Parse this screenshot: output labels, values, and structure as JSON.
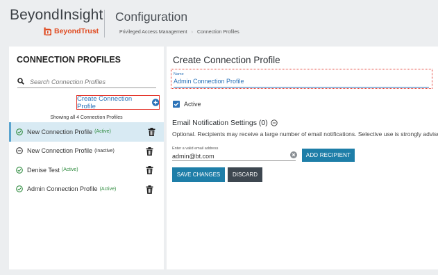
{
  "header": {
    "brand": "BeyondInsight",
    "vendor_logo": "BeyondTrust",
    "app_title": "Configuration",
    "breadcrumb": [
      "Privileged Access Management",
      "Connection Profiles"
    ]
  },
  "left_panel": {
    "heading": "CONNECTION PROFILES",
    "search_placeholder": "Search Connection Profiles",
    "create_label": "Create Connection Profile",
    "showing_text": "Showing all 4 Connection Profiles",
    "profiles": [
      {
        "name": "New Connection Profile",
        "status": "(Active)",
        "state": "active",
        "selected": true
      },
      {
        "name": "New Connection Profile",
        "status": "(Inactive)",
        "state": "inactive",
        "selected": false
      },
      {
        "name": "Denise Test",
        "status": "(Active)",
        "state": "active",
        "selected": false
      },
      {
        "name": "Admin Connection Profile",
        "status": "(Active)",
        "state": "active",
        "selected": false
      }
    ]
  },
  "form": {
    "title": "Create Connection Profile",
    "name_label": "Name",
    "name_value": "Admin Connection Profile",
    "active_label": "Active",
    "active_checked": true,
    "email_heading": "Email Notification Settings (0)",
    "email_description": "Optional. Recipients may receive a large number of email notifications. Selective use is strongly advised.",
    "email_label": "Enter a valid email address",
    "email_value": "admin@bt.com",
    "add_recipient_label": "ADD RECIPIENT",
    "save_label": "SAVE CHANGES",
    "discard_label": "DISCARD"
  },
  "colors": {
    "accent_blue": "#2a72b8",
    "button_blue": "#1e7ea8",
    "discard_dark": "#3d4750",
    "brand_orange": "#e04a1f",
    "active_green": "#2e8b3e",
    "selected_row": "#d8eaf3",
    "highlight_red": "#e3352b"
  },
  "icons": [
    "beyondtrust-logo-icon",
    "search-icon",
    "plus-circle-icon",
    "check-circle-icon",
    "minus-circle-icon",
    "trash-icon",
    "checkbox-checked-icon",
    "collapse-icon",
    "clear-icon"
  ]
}
